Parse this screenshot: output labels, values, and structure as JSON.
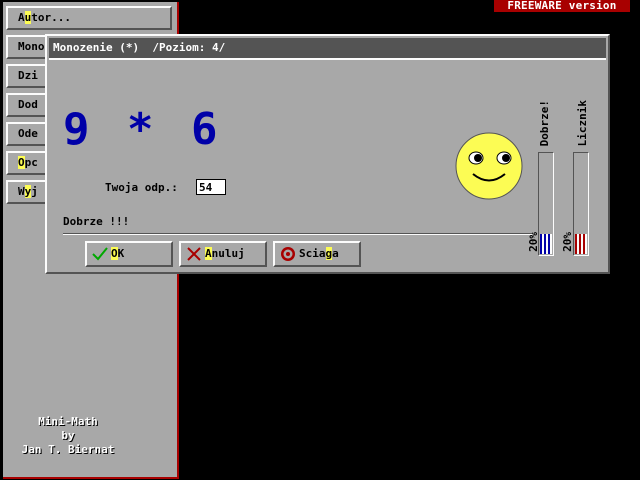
{
  "badge": {
    "text": "FREEWARE version"
  },
  "menu": {
    "items": [
      {
        "pre": "A",
        "hot": "u",
        "post": "tor..."
      },
      {
        "pre": "Mono",
        "hot": "",
        "post": ""
      },
      {
        "pre": "Dzi",
        "hot": "",
        "post": ""
      },
      {
        "pre": "Dod",
        "hot": "",
        "post": ""
      },
      {
        "pre": "Ode",
        "hot": "",
        "post": ""
      },
      {
        "pre": "",
        "hot": "O",
        "post": "pc"
      },
      {
        "pre": "W",
        "hot": "y",
        "post": "j"
      }
    ],
    "credits": {
      "line1": "Mini-Math",
      "line2": "by",
      "line3": "Jan T. Biernat"
    }
  },
  "dialog": {
    "title": "Monozenie (*)  /Poziom: 4/",
    "problem": {
      "a": "9",
      "op": "*",
      "b": "6"
    },
    "answer_label": "Twoja odp.:",
    "answer_value": "54",
    "feedback": "Dobrze !!!",
    "buttons": {
      "ok": {
        "hot": "O",
        "rest": "K"
      },
      "cancel": {
        "hot": "A",
        "rest": "nuluj"
      },
      "cheat": {
        "pre": "Scia",
        "hot": "g",
        "post": "a"
      }
    },
    "meters": {
      "correct": {
        "label": "Dobrze!",
        "percent_label": "20%",
        "level": 0.2,
        "color": "#0000a8"
      },
      "counter": {
        "label": "Licznik",
        "percent_label": "20%",
        "level": 0.2,
        "color": "#a80000"
      }
    }
  },
  "icons": {
    "ok": "checkmark-icon",
    "cancel": "x-mark-icon",
    "cheat": "target-icon",
    "face": "smiley-face-icon"
  },
  "colors": {
    "desktop": "#000000",
    "panel": "#a8a8a8",
    "titlebar": "#545454",
    "badge": "#a80000",
    "hotkey": "#fcfc54",
    "problem_text": "#0000a8",
    "smiley": "#fcfc54"
  }
}
